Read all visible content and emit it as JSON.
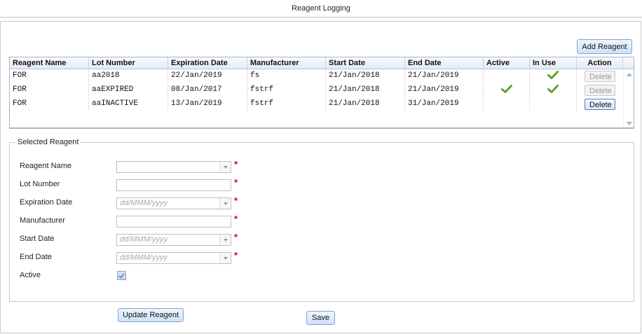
{
  "page": {
    "title": "Reagent Logging"
  },
  "toolbar": {
    "add_label": "Add Reagent"
  },
  "grid": {
    "headers": {
      "reagent_name": "Reagent Name",
      "lot_number": "Lot Number",
      "expiration_date": "Expiration Date",
      "manufacturer": "Manufacturer",
      "start_date": "Start Date",
      "end_date": "End Date",
      "active": "Active",
      "in_use": "In Use",
      "action": "Action"
    },
    "rows": [
      {
        "reagent_name": "FOR",
        "lot_number": "aa2018",
        "expiration_date": "22/Jan/2019",
        "manufacturer": "fs",
        "start_date": "21/Jan/2018",
        "end_date": "21/Jan/2019",
        "active": false,
        "in_use": true,
        "action": "Delete",
        "delete_enabled": false
      },
      {
        "reagent_name": "FOR",
        "lot_number": "aaEXPIRED",
        "expiration_date": "08/Jan/2017",
        "manufacturer": "fstrf",
        "start_date": "21/Jan/2018",
        "end_date": "21/Jan/2019",
        "active": true,
        "in_use": true,
        "action": "Delete",
        "delete_enabled": false
      },
      {
        "reagent_name": "FOR",
        "lot_number": "aaINACTIVE",
        "expiration_date": "13/Jan/2019",
        "manufacturer": "fstrf",
        "start_date": "21/Jan/2018",
        "end_date": "31/Jan/2019",
        "active": false,
        "in_use": false,
        "action": "Delete",
        "delete_enabled": true
      }
    ]
  },
  "selected": {
    "legend": "Selected Reagent",
    "labels": {
      "reagent_name": "Reagent Name",
      "lot_number": "Lot Number",
      "expiration_date": "Expiration Date",
      "manufacturer": "Manufacturer",
      "start_date": "Start Date",
      "end_date": "End Date",
      "active": "Active"
    },
    "values": {
      "reagent_name": "",
      "lot_number": "",
      "expiration_date": "",
      "manufacturer": "",
      "start_date": "",
      "end_date": "",
      "active": true
    },
    "placeholders": {
      "expiration_date": "dd/MMM/yyyy",
      "start_date": "dd/MMM/yyyy",
      "end_date": "dd/MMM/yyyy"
    },
    "required_mark": "*",
    "update_label": "Update Reagent"
  },
  "footer": {
    "save_label": "Save"
  },
  "icons": {
    "check": "checkmark-icon"
  },
  "colors": {
    "check_green": "#5fa327",
    "required": "#d8001e",
    "accent": "#7ea6d3"
  }
}
